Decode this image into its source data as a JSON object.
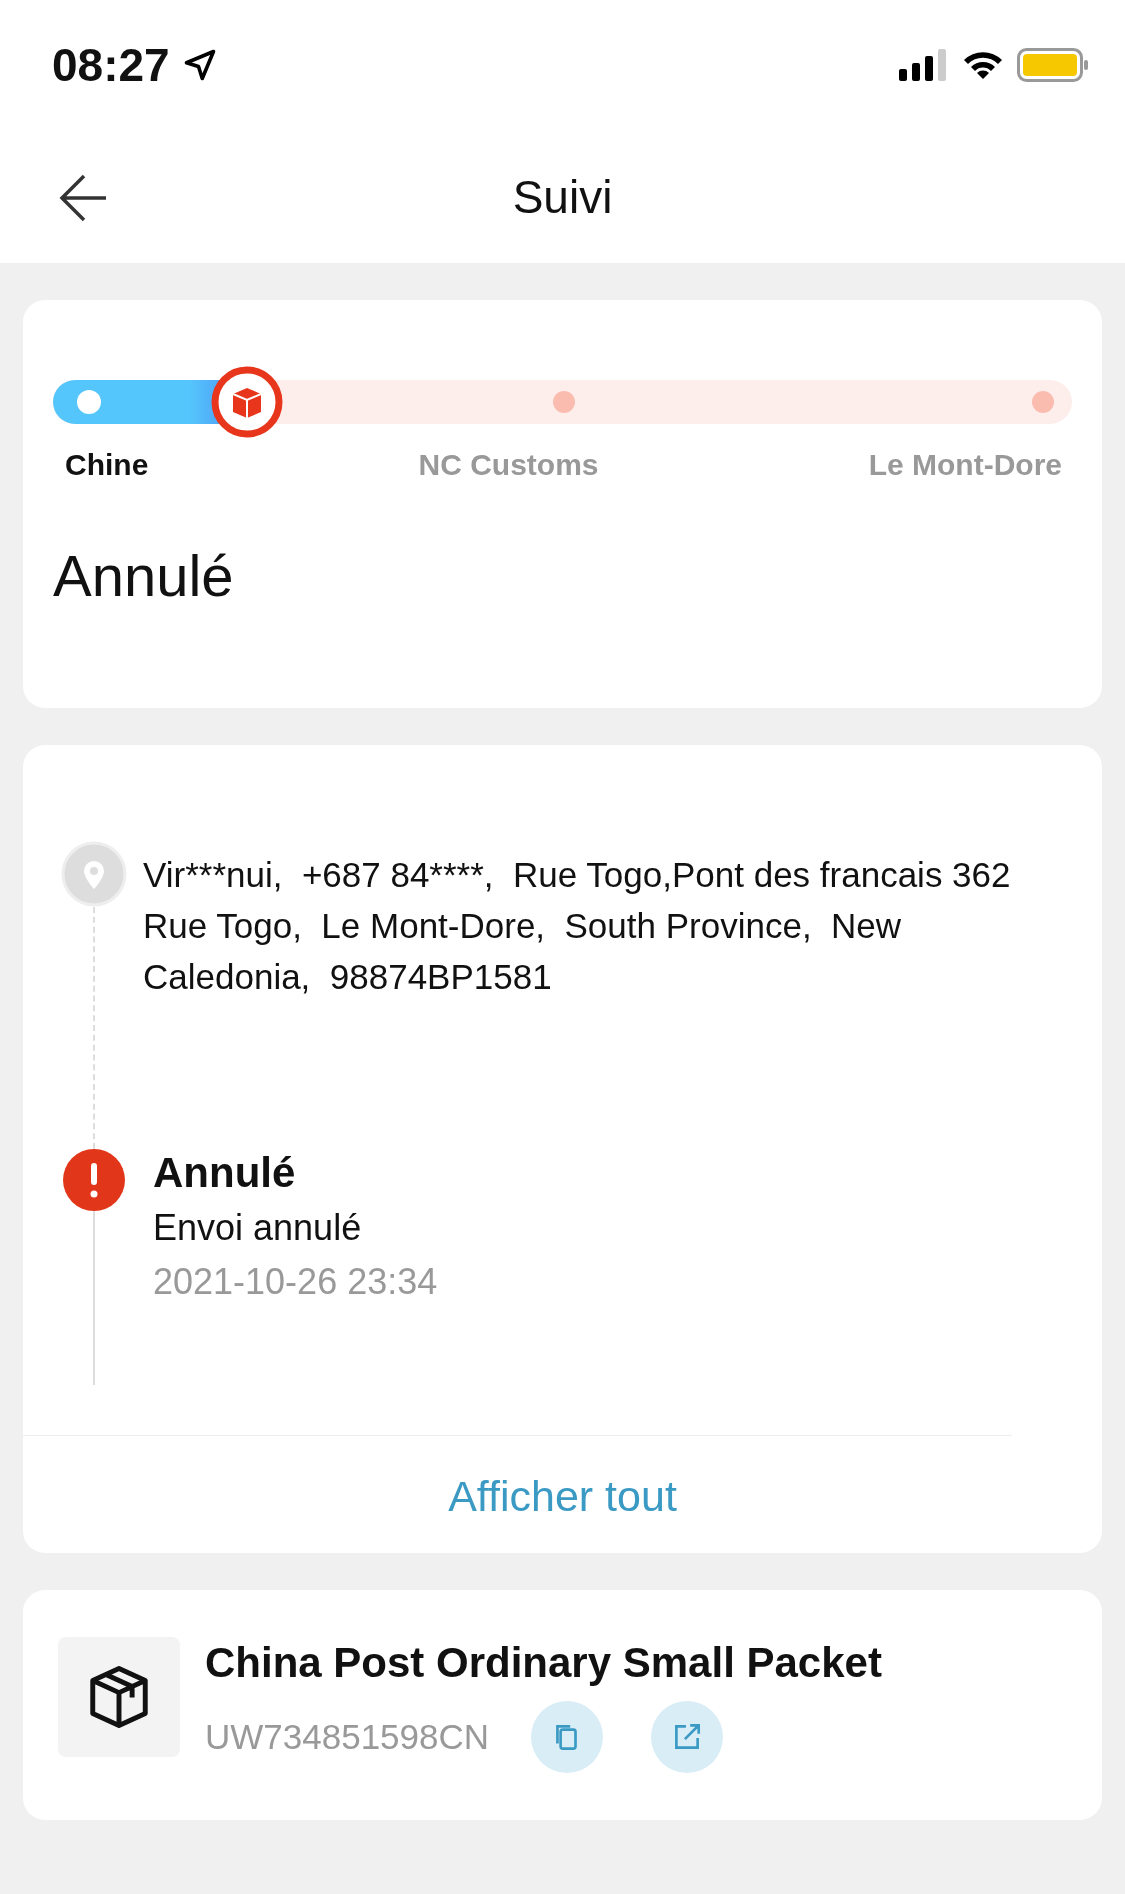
{
  "status_bar": {
    "time": "08:27"
  },
  "header": {
    "title": "Suivi"
  },
  "progress": {
    "level": 0.19,
    "stops": [
      {
        "label": "Chine",
        "reached": true
      },
      {
        "label": "NC Customs",
        "reached": false
      },
      {
        "label": "Le Mont-Dore",
        "reached": false
      }
    ],
    "status": "Annulé"
  },
  "timeline": {
    "address": "Vir***nui,  +687 84****,  Rue Togo,Pont des francais 362 Rue Togo,  Le Mont-Dore,  South Province,  New Caledonia,  98874BP1581",
    "events": [
      {
        "kind": "cancelled",
        "title": "Annulé",
        "detail": "Envoi annulé",
        "time": "2021-10-26 23:34"
      }
    ],
    "show_all": "Afficher tout"
  },
  "carrier": {
    "name": "China Post Ordinary Small Packet",
    "tracking_number": "UW734851598CN"
  }
}
